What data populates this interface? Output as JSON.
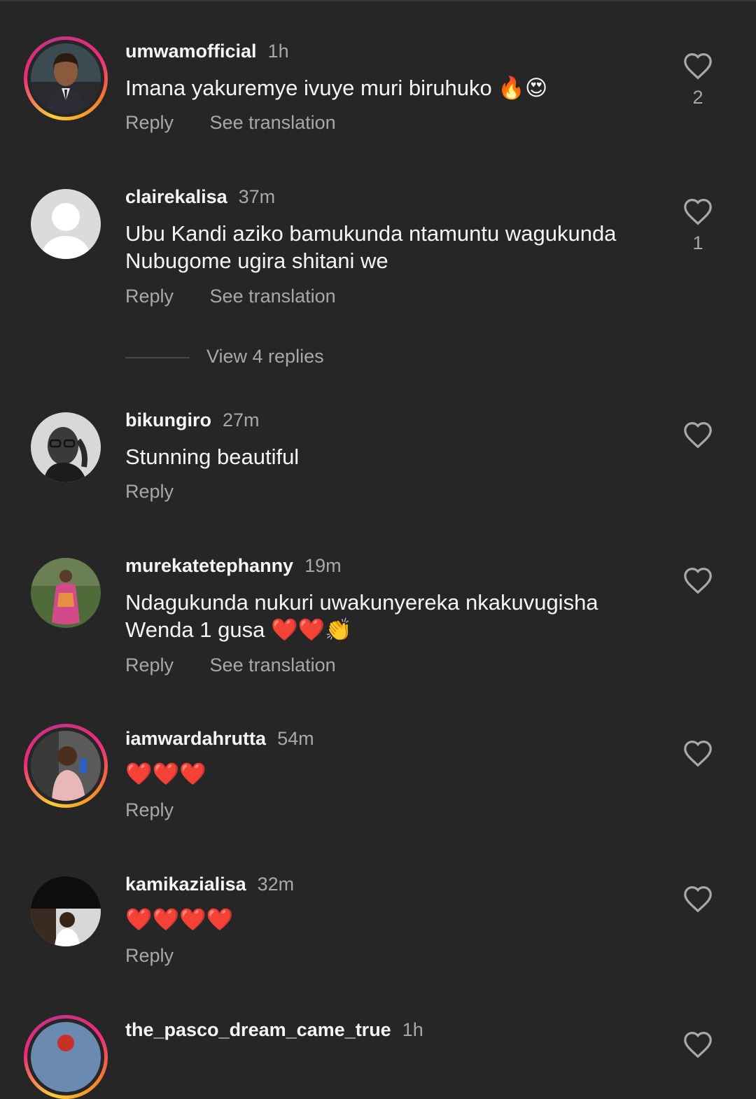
{
  "comments": [
    {
      "username": "umwamofficial",
      "time": "1h",
      "text": "Imana yakuremye ivuye muri biruhuko 🔥😍",
      "reply": "Reply",
      "translation": "See translation",
      "likes": "2",
      "story_ring": true
    },
    {
      "username": "clairekalisa",
      "time": "37m",
      "text": "Ubu Kandi aziko bamukunda ntamuntu wagukunda Nubugome ugira shitani we",
      "reply": "Reply",
      "translation": "See translation",
      "likes": "1",
      "story_ring": false
    },
    {
      "username": "bikungiro",
      "time": "27m",
      "text": "Stunning beautiful",
      "reply": "Reply",
      "story_ring": false
    },
    {
      "username": "murekatetephanny",
      "time": "19m",
      "text": "Ndagukunda nukuri uwakunyereka nkakuvugisha Wenda 1 gusa ❤️❤️👏",
      "reply": "Reply",
      "translation": "See translation",
      "story_ring": false
    },
    {
      "username": "iamwardahrutta",
      "time": "54m",
      "text": "❤️❤️❤️",
      "reply": "Reply",
      "story_ring": true
    },
    {
      "username": "kamikazialisa",
      "time": "32m",
      "text": "❤️❤️❤️❤️",
      "reply": "Reply",
      "story_ring": false
    },
    {
      "username": "the_pasco_dream_came_true",
      "time": "1h",
      "story_ring": true
    }
  ],
  "view_replies": "View 4 replies",
  "icons": {
    "like": "heart-outline-icon"
  },
  "colors": {
    "background": "#262626",
    "text_primary": "#f5f5f5",
    "text_secondary": "#a8a8a8"
  }
}
